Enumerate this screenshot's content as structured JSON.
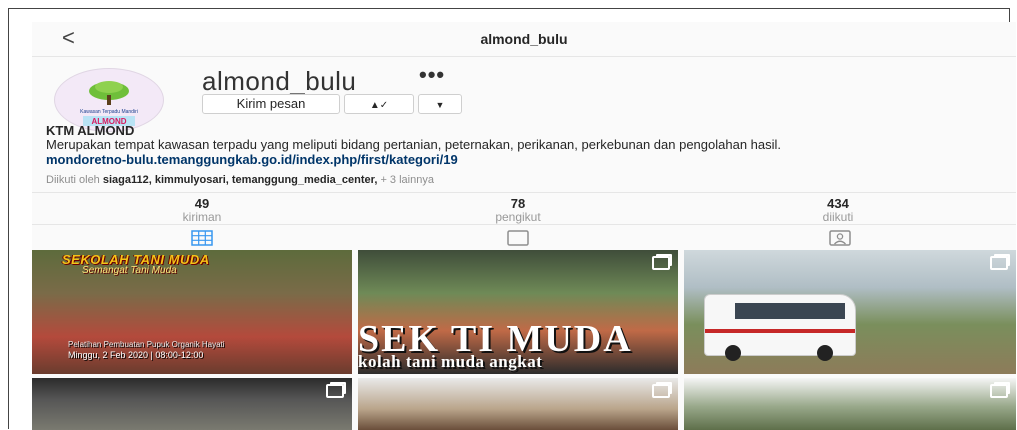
{
  "nav": {
    "back_glyph": "<",
    "title": "almond_bulu"
  },
  "profile": {
    "username": "almond_bulu",
    "more_glyph": "•••",
    "buttons": {
      "message": "Kirim pesan",
      "follow_glyph": "▲✓",
      "dropdown_glyph": "▼"
    }
  },
  "avatar_text": {
    "line1": "Kawasan Terpadu Mandiri",
    "line2": "ALMOND"
  },
  "bio": {
    "name": "KTM ALMOND",
    "description": "Merupakan tempat kawasan terpadu yang meliputi bidang pertanian, peternakan, perikanan, perkebunan dan pengolahan hasil.",
    "link": "mondoretno-bulu.temanggungkab.go.id/index.php/first/kategori/19"
  },
  "followed_by": {
    "prefix": "Diikuti oleh",
    "names": "siaga112, kimmulyosari, temanggung_media_center,",
    "more": "+ 3 lainnya"
  },
  "stats": [
    {
      "count": "49",
      "label": "kiriman"
    },
    {
      "count": "78",
      "label": "pengikut"
    },
    {
      "count": "434",
      "label": "diikuti"
    }
  ],
  "posts": {
    "p1_title": "SEKOLAH TANI MUDA",
    "p1_sub": "Semangat Tani Muda",
    "p1_caption": "Pelatihan Pembuatan Pupuk Organik Hayati",
    "p1_date": "Minggu, 2 Feb 2020 | 08:00-12:00",
    "p2_big": "SEK TI MUDA",
    "p2_small": "kolah tani muda angkat"
  },
  "colors": {
    "accent_tab": "#3897f0",
    "link": "#003569",
    "muted": "#8e8e8e"
  },
  "icons": [
    "back-icon",
    "more-icon",
    "person-check-icon",
    "chevron-down-icon",
    "grid-icon",
    "tv-icon",
    "tagged-icon",
    "multi-post-icon"
  ]
}
